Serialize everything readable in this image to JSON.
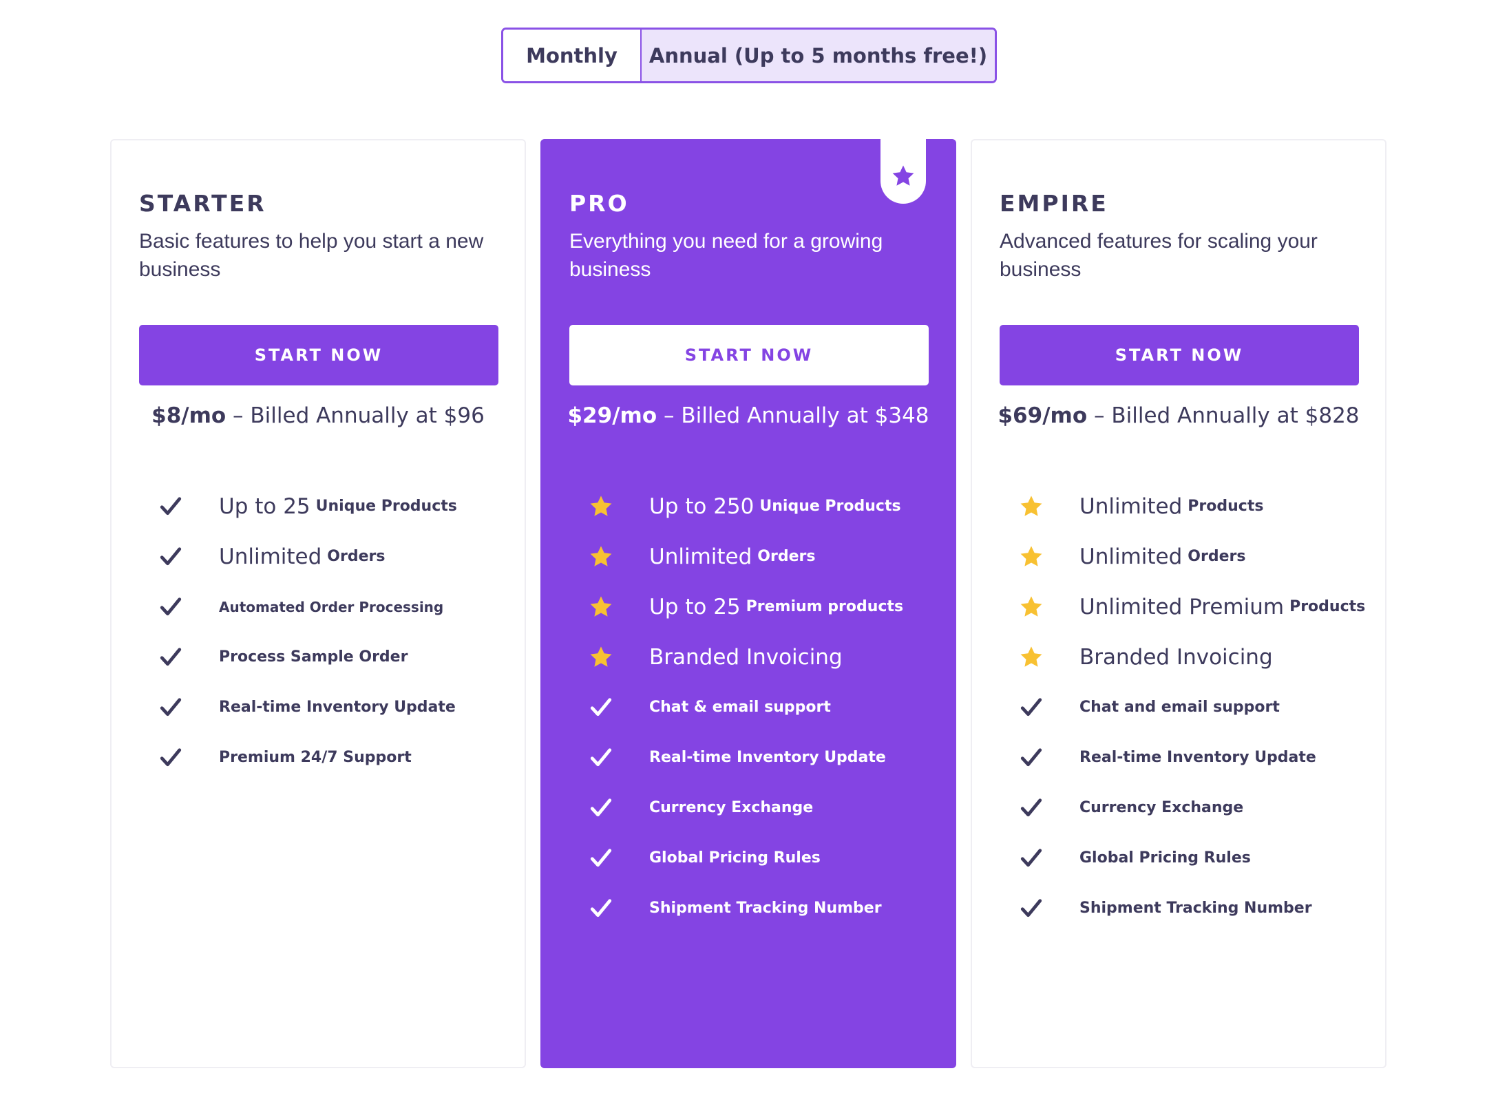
{
  "billing_toggle": {
    "monthly_label": "Monthly",
    "annual_label": "Annual (Up to 5 months free!)",
    "selected": "Annual (Up to 5 months free!)"
  },
  "colors": {
    "brand_purple": "#8444e3",
    "text_dark": "#3d3a5c",
    "star_gold": "#f8c132",
    "toggle_selected_bg": "#ece4fb"
  },
  "plans": [
    {
      "name": "STARTER",
      "description": "Basic features to help you start a new business",
      "button_label": "START NOW",
      "price": "$8/mo",
      "billing": " – Billed Annually at $96",
      "features": [
        {
          "main": "Up to 25",
          "sub": "Unique Products",
          "icon": "check-icon"
        },
        {
          "main": "Unlimited",
          "sub": "Orders",
          "icon": "check-icon"
        },
        {
          "main": "",
          "sub": "Automated Order Processing",
          "icon": "check-icon"
        },
        {
          "main": "",
          "sub": "Process Sample Order",
          "icon": "check-icon"
        },
        {
          "main": "",
          "sub": "Real-time Inventory Update",
          "icon": "check-icon"
        },
        {
          "main": "",
          "sub": "Premium 24/7 Support",
          "icon": "check-icon"
        }
      ]
    },
    {
      "name": "PRO",
      "description": "Everything you need for a growing business",
      "button_label": "START NOW",
      "price": "$29/mo",
      "billing": " – Billed Annually at $348",
      "badge_icon": "star-icon",
      "features": [
        {
          "main": "Up to 250",
          "sub": "Unique Products",
          "icon": "star-icon"
        },
        {
          "main": "Unlimited",
          "sub": "Orders",
          "icon": "star-icon"
        },
        {
          "main": "Up to 25",
          "sub": "Premium products",
          "icon": "star-icon"
        },
        {
          "main": "Branded Invoicing",
          "sub": "",
          "icon": "star-icon"
        },
        {
          "main": "",
          "sub": "Chat & email support",
          "icon": "check-icon"
        },
        {
          "main": "",
          "sub": "Real-time Inventory Update",
          "icon": "check-icon"
        },
        {
          "main": "",
          "sub": "Currency Exchange",
          "icon": "check-icon"
        },
        {
          "main": "",
          "sub": "Global Pricing Rules",
          "icon": "check-icon"
        },
        {
          "main": "",
          "sub": "Shipment Tracking Number",
          "icon": "check-icon"
        }
      ]
    },
    {
      "name": "EMPIRE",
      "description": "Advanced features for scaling your business",
      "button_label": "START NOW",
      "price": "$69/mo",
      "billing": " – Billed Annually at $828",
      "features": [
        {
          "main": "Unlimited",
          "sub": "Products",
          "icon": "star-icon"
        },
        {
          "main": "Unlimited",
          "sub": "Orders",
          "icon": "star-icon"
        },
        {
          "main": "Unlimited Premium",
          "sub": "Products",
          "icon": "star-icon"
        },
        {
          "main": "Branded Invoicing",
          "sub": "",
          "icon": "star-icon"
        },
        {
          "main": "",
          "sub": "Chat and email support",
          "icon": "check-icon"
        },
        {
          "main": "",
          "sub": "Real-time Inventory Update",
          "icon": "check-icon"
        },
        {
          "main": "",
          "sub": "Currency Exchange",
          "icon": "check-icon"
        },
        {
          "main": "",
          "sub": "Global Pricing Rules",
          "icon": "check-icon"
        },
        {
          "main": "",
          "sub": "Shipment Tracking Number",
          "icon": "check-icon"
        }
      ]
    }
  ]
}
